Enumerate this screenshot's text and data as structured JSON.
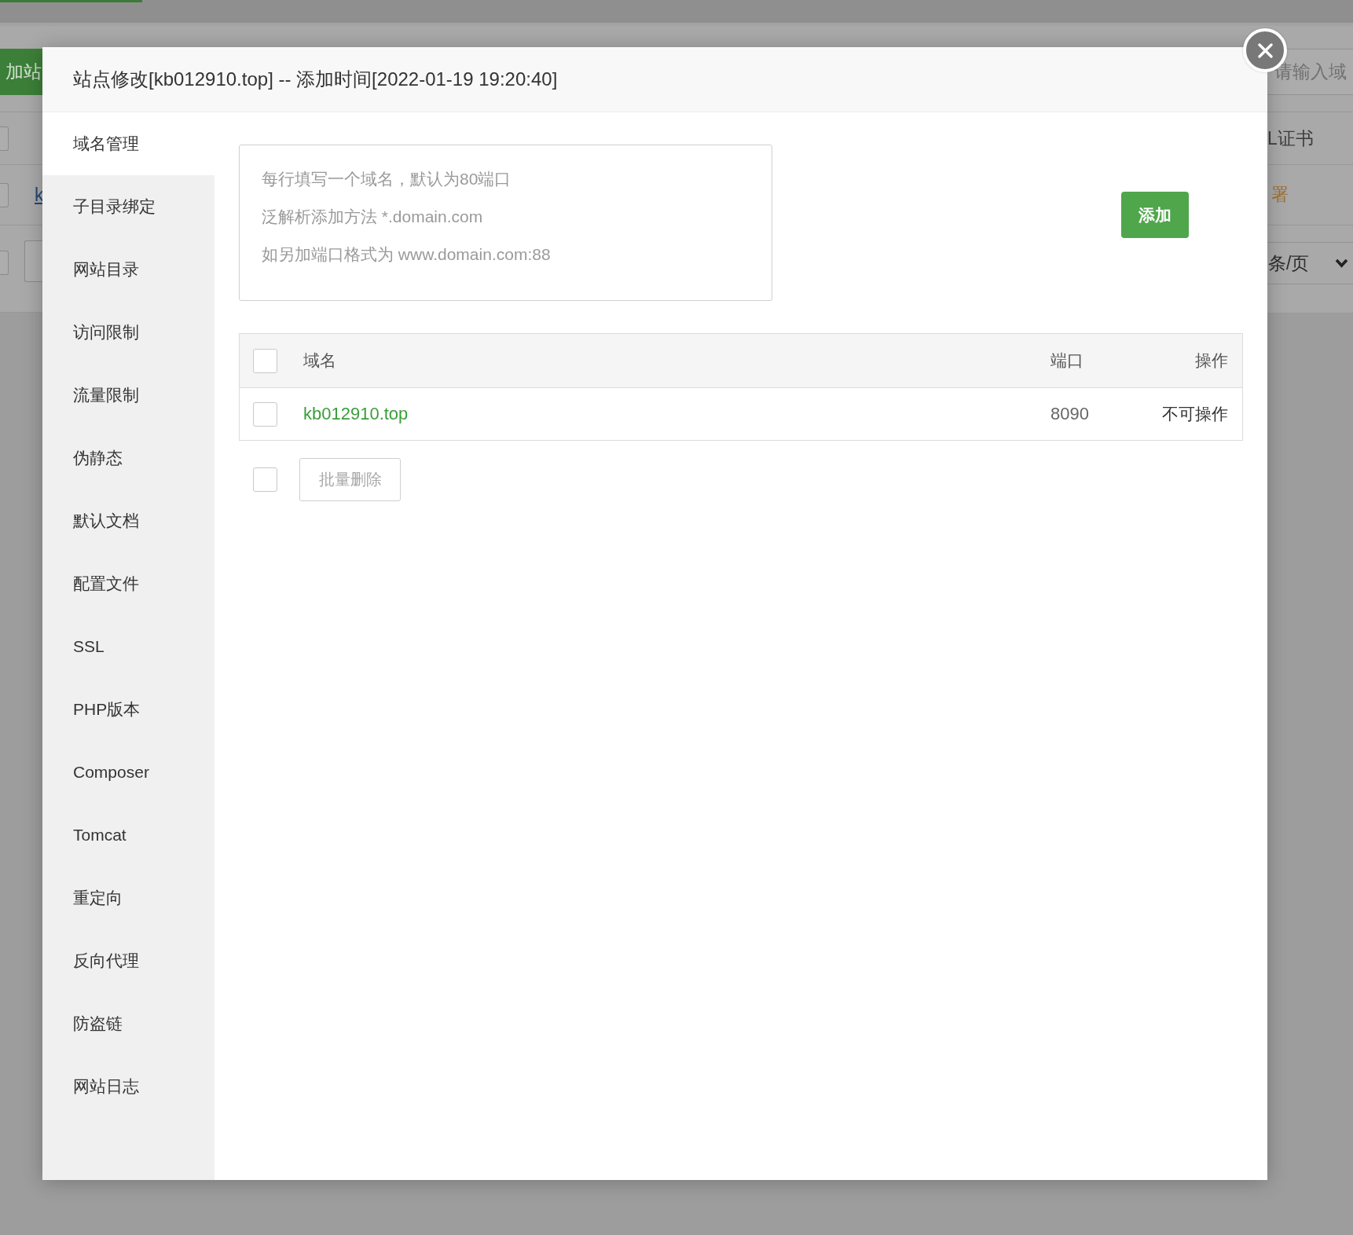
{
  "background_page": {
    "add_site_button": "加站",
    "search_field": {
      "placeholder": "请输入域"
    },
    "table": {
      "select_all": {
        "checked": false
      },
      "columns": [
        "L证书"
      ],
      "rows": [
        {
          "checked": false,
          "site_link": "k",
          "ssl_status": "署"
        }
      ]
    },
    "footer": {
      "select_all": {
        "checked": false
      }
    },
    "pagination": {
      "page_size": "条/页"
    }
  },
  "dialog": {
    "title": "站点修改[kb012910.top] -- 添加时间[2022-01-19 19:20:40]",
    "sidebar": {
      "items": [
        {
          "label": "域名管理",
          "selected": true
        },
        {
          "label": "子目录绑定",
          "selected": false
        },
        {
          "label": "网站目录",
          "selected": false
        },
        {
          "label": "访问限制",
          "selected": false
        },
        {
          "label": "流量限制",
          "selected": false
        },
        {
          "label": "伪静态",
          "selected": false
        },
        {
          "label": "默认文档",
          "selected": false
        },
        {
          "label": "配置文件",
          "selected": false
        },
        {
          "label": "SSL",
          "selected": false
        },
        {
          "label": "PHP版本",
          "selected": false
        },
        {
          "label": "Composer",
          "selected": false
        },
        {
          "label": "Tomcat",
          "selected": false
        },
        {
          "label": "重定向",
          "selected": false
        },
        {
          "label": "反向代理",
          "selected": false
        },
        {
          "label": "防盗链",
          "selected": false
        },
        {
          "label": "网站日志",
          "selected": false
        }
      ]
    },
    "domain_input": {
      "placeholder": [
        "每行填写一个域名，默认为80端口",
        "泛解析添加方法 *.domain.com",
        "如另加端口格式为 www.domain.com:88"
      ]
    },
    "add_button": "添加",
    "table": {
      "select_all": {
        "checked": false
      },
      "columns": [
        "域名",
        "端口",
        "操作"
      ],
      "rows": [
        {
          "checked": false,
          "domain": "kb012910.top",
          "port": "8090",
          "action": "不可操作"
        }
      ]
    },
    "footer": {
      "select_all": {
        "checked": false
      },
      "batch_delete_button": {
        "label": "批量删除",
        "disabled": true
      }
    }
  }
}
